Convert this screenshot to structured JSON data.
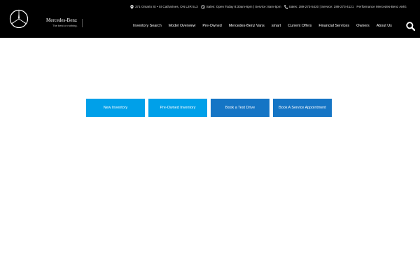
{
  "colors": {
    "header_bg": "#000000",
    "light_button": "#00a0e9",
    "dark_button": "#1575c5",
    "page_bg": "#ffffff"
  },
  "brand": {
    "logo_icon": "mercedes-star-icon",
    "name": "Mercedes-Benz",
    "tagline": "The best or nothing."
  },
  "topbar": {
    "address": "371 Ontario St • St Catharines, ON L2R 5L3",
    "hours": "Sales: Open Today 8:30am-6pm | Service: 8am-5pm",
    "phones": "Sales: 289-273-5420 | Service: 289-273-4121",
    "dealer": "Performance Mercedes-Benz AMG"
  },
  "nav": [
    "Inventory Search",
    "Model Overview",
    "Pre-Owned",
    "Mercedes-Benz Vans",
    "smart",
    "Current Offers",
    "Financial Services",
    "Owners",
    "About Us"
  ],
  "buttons": [
    "New Inventory",
    "Pre-Owned Inventory",
    "Book a Test Drive",
    "Book A Service Appointment"
  ]
}
